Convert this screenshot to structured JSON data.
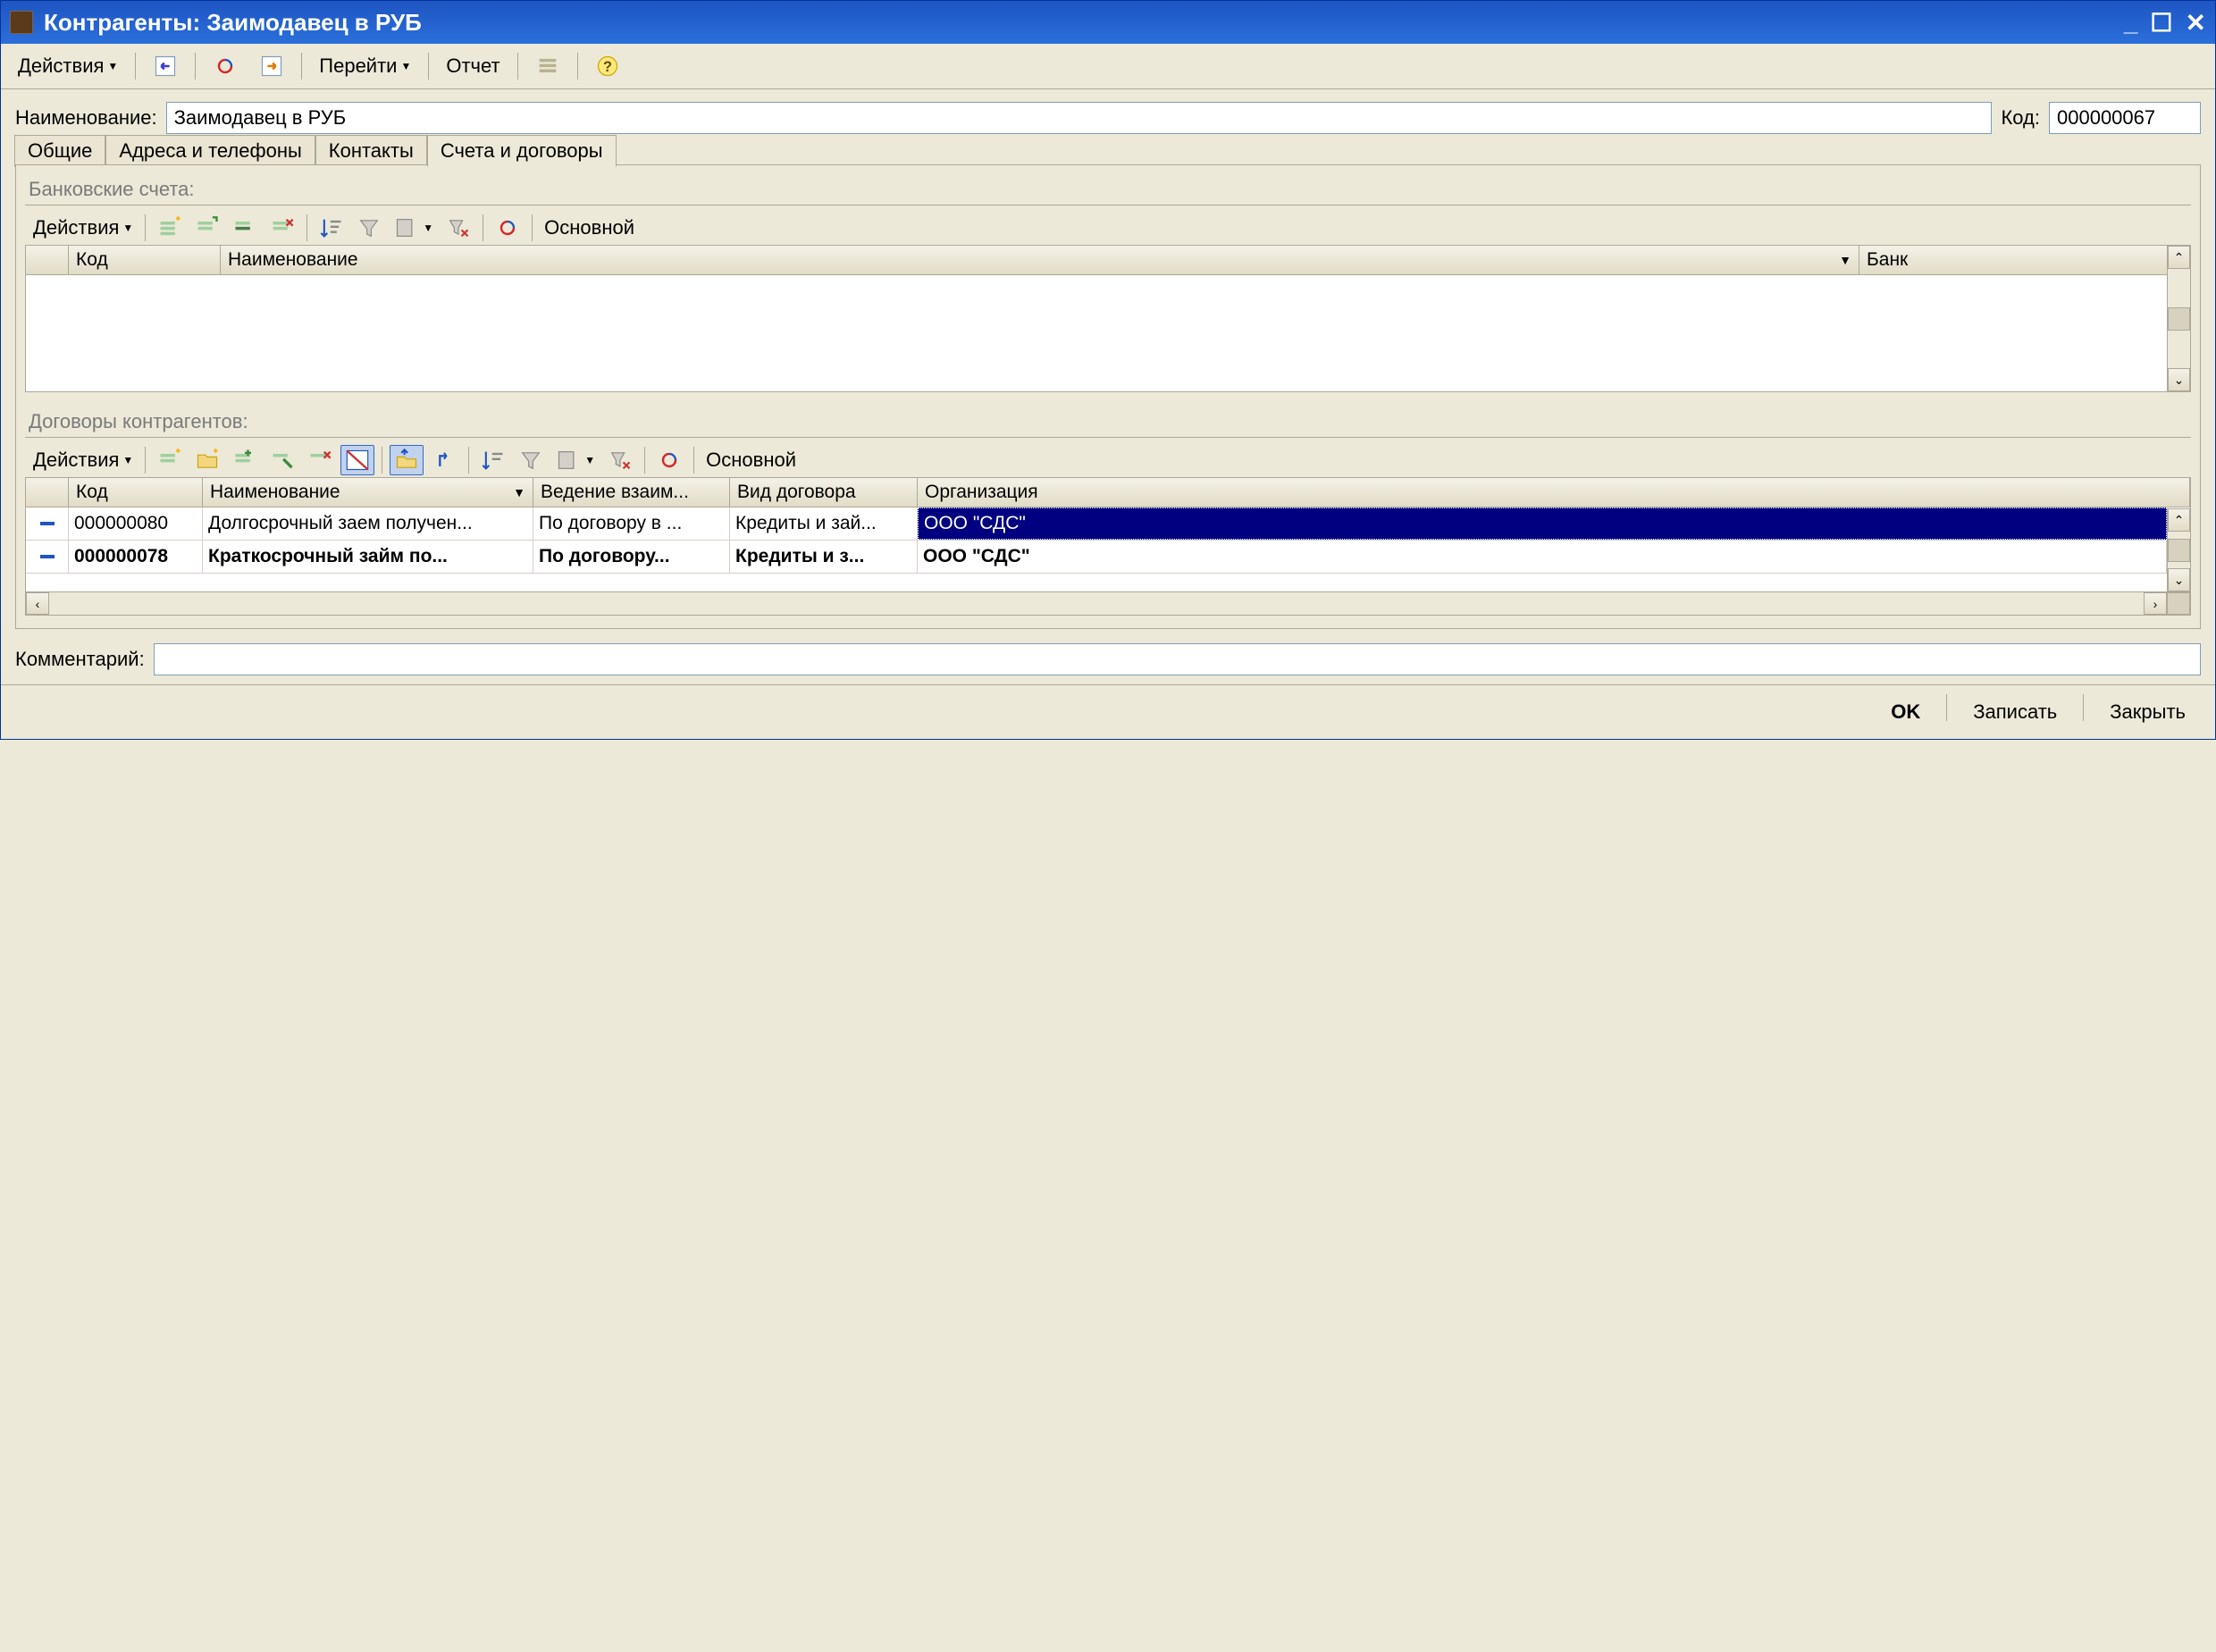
{
  "titlebar": {
    "title": "Контрагенты: Заимодавец в РУБ"
  },
  "toolbar": {
    "actions": "Действия",
    "goto": "Перейти",
    "report": "Отчет"
  },
  "fields": {
    "name_label": "Наименование:",
    "name_value": "Заимодавец в РУБ",
    "code_label": "Код:",
    "code_value": "000000067",
    "comment_label": "Комментарий:",
    "comment_value": ""
  },
  "tabs": {
    "t0": "Общие",
    "t1": "Адреса и телефоны",
    "t2": "Контакты",
    "t3": "Счета и договоры"
  },
  "bank_section": {
    "title": "Банковские счета:",
    "actions": "Действия",
    "main_btn": "Основной",
    "columns": {
      "c0": "",
      "c1": "Код",
      "c2": "Наименование",
      "c3": "Банк"
    }
  },
  "contracts_section": {
    "title": "Договоры контрагентов:",
    "actions": "Действия",
    "main_btn": "Основной",
    "columns": {
      "c0": "",
      "c1": "Код",
      "c2": "Наименование",
      "c3": "Ведение взаим...",
      "c4": "Вид договора",
      "c5": "Организация"
    },
    "rows": [
      {
        "code": "000000080",
        "name": "Долгосрочный заем получен...",
        "vedenie": "По договору в ...",
        "vid": "Кредиты и зай...",
        "org": "ООО \"СДС\"",
        "bold": false,
        "selected_org": true
      },
      {
        "code": "000000078",
        "name": "Краткосрочный займ по...",
        "vedenie": "По договору...",
        "vid": "Кредиты и з...",
        "org": "ООО \"СДС\"",
        "bold": true,
        "selected_org": false
      }
    ]
  },
  "buttons": {
    "ok": "OK",
    "save": "Записать",
    "close": "Закрыть"
  }
}
